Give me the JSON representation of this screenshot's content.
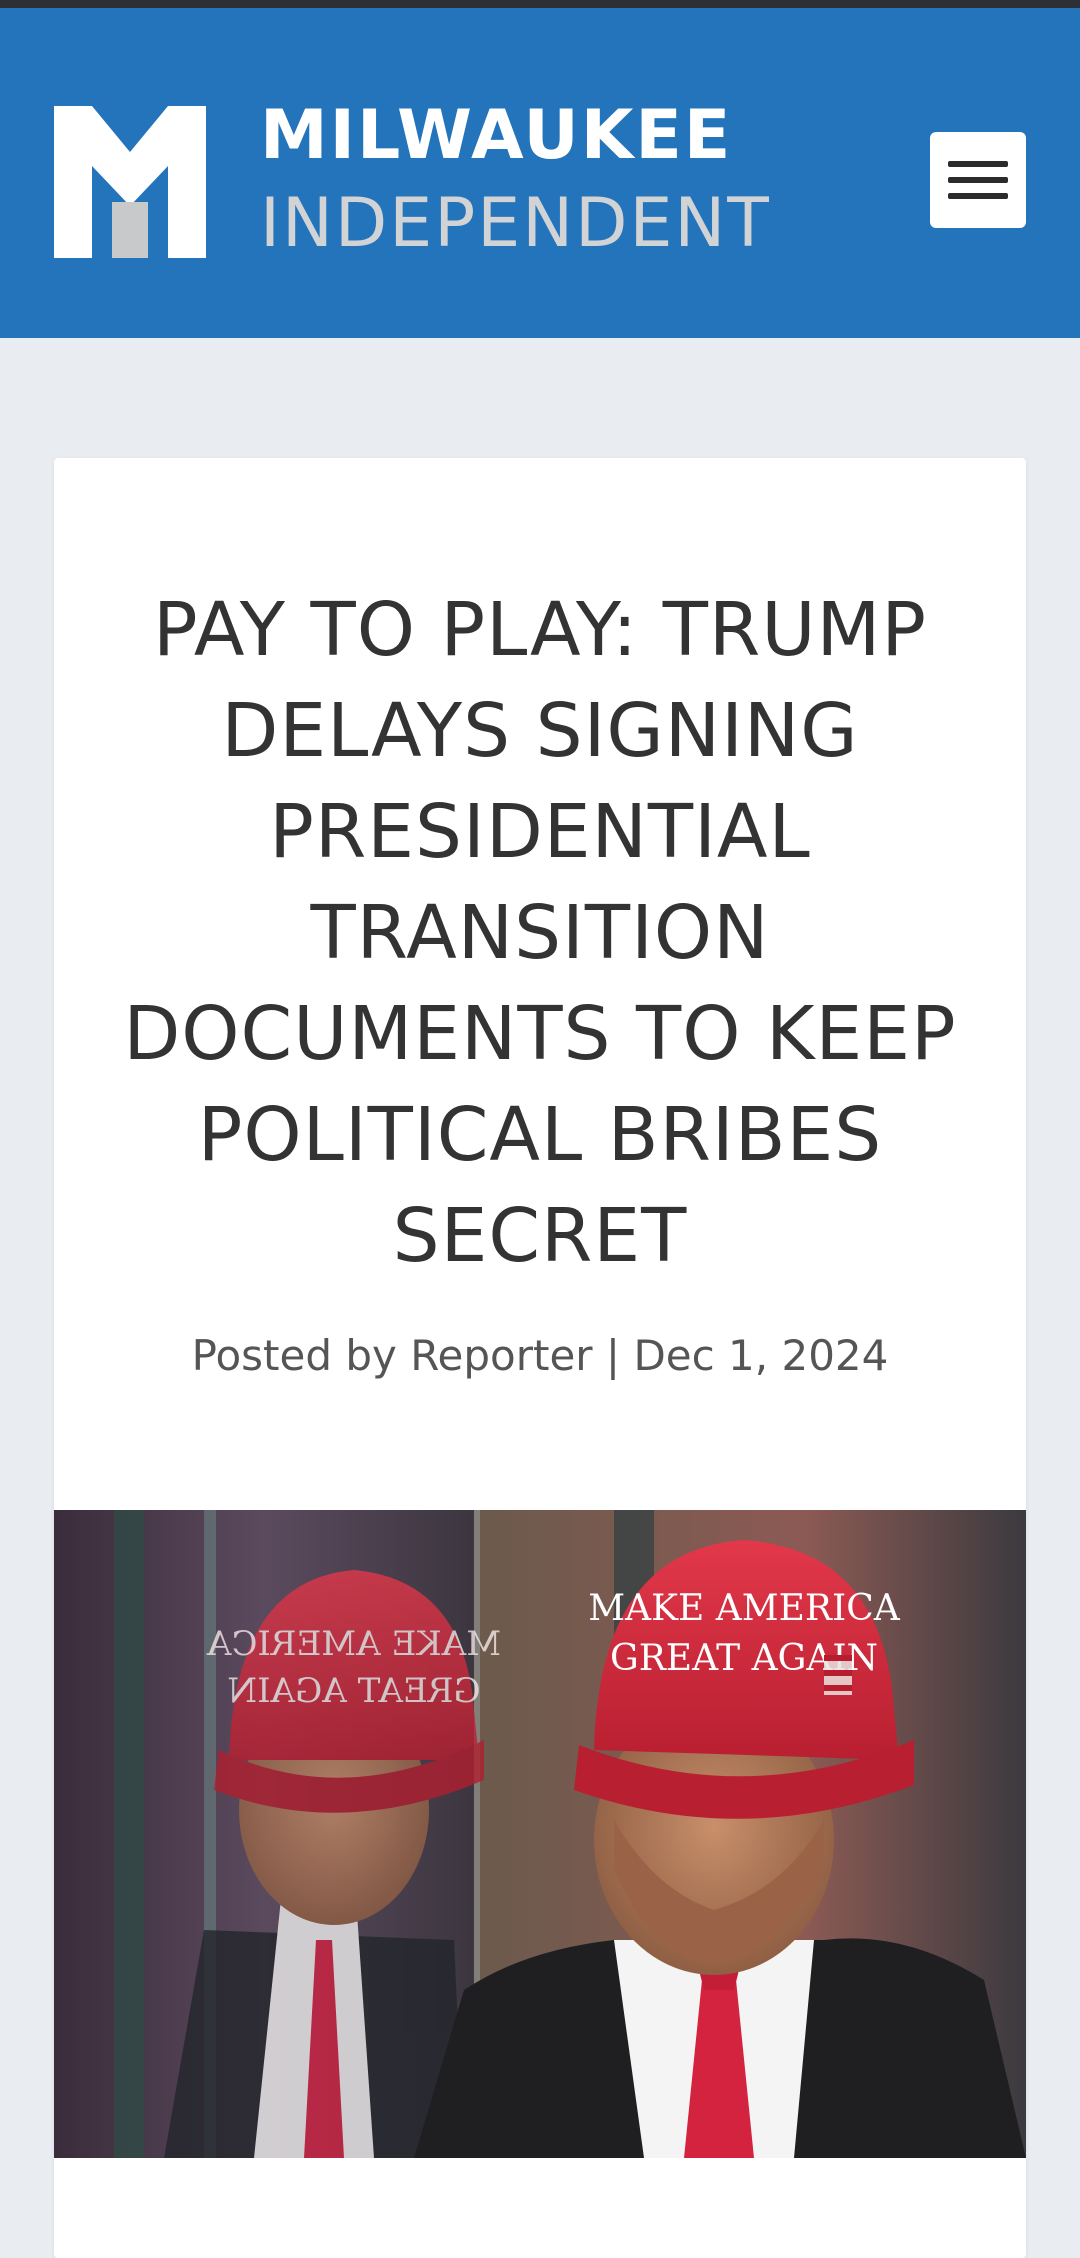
{
  "header": {
    "logo": {
      "line1": "MILWAUKEE",
      "line2": "INDEPENDENT"
    },
    "menu_icon": "hamburger-menu-icon"
  },
  "article": {
    "title": "PAY TO PLAY: TRUMP DELAYS SIGNING PRESIDENTIAL TRANSITION DOCUMENTS TO KEEP POLITICAL BRIBES SECRET",
    "meta": {
      "prefix": "Posted by",
      "author": "Reporter",
      "separator": "|",
      "date": "Dec 1, 2024"
    },
    "image": {
      "hat_text_line1": "MAKE AMERICA",
      "hat_text_line2": "GREAT AGAIN"
    }
  },
  "colors": {
    "header_bg": "#2474bc",
    "page_bg": "#e9edf2",
    "hat_red": "#d52a3a",
    "tie_red": "#d4233f"
  }
}
